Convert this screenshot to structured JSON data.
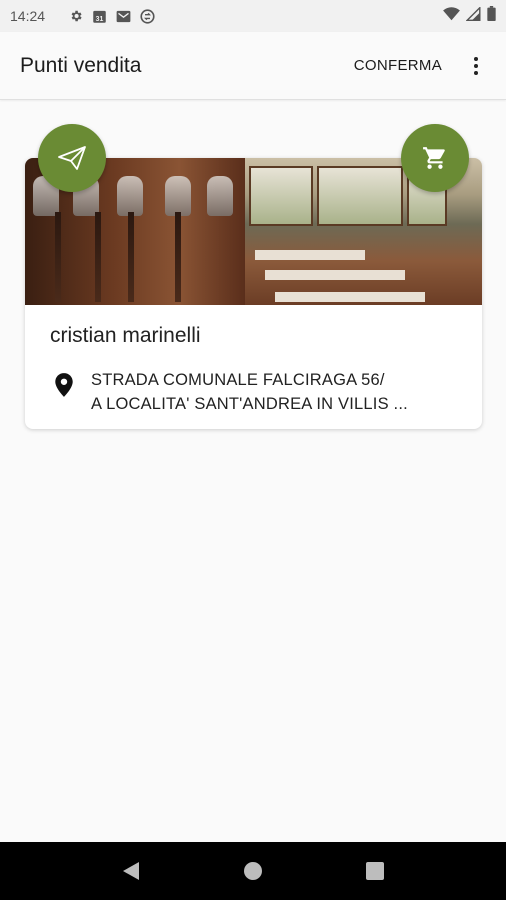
{
  "status_bar": {
    "time": "14:24",
    "left_icons": [
      "gear-icon",
      "calendar-icon",
      "gmail-icon",
      "sync-icon"
    ],
    "calendar_day": "31",
    "right_icons": [
      "wifi-icon",
      "signal-icon",
      "battery-icon"
    ]
  },
  "app_bar": {
    "title": "Punti vendita",
    "confirm_label": "CONFERMA",
    "overflow_icon": "more-vert-icon"
  },
  "colors": {
    "accent": "#6a8b34",
    "background": "#fafafa",
    "card": "#ffffff",
    "nav_bar": "#000000"
  },
  "store_card": {
    "name": "cristian marinelli",
    "address_line1": "STRADA COMUNALE FALCIRAGA 56/",
    "address_line2": "A LOCALITA' SANT'ANDREA IN VILLIS ...",
    "send_icon": "send-icon",
    "cart_icon": "cart-icon",
    "location_icon": "location-pin-icon"
  },
  "nav_bar": {
    "buttons": [
      "back-icon",
      "home-icon",
      "recents-icon"
    ]
  }
}
